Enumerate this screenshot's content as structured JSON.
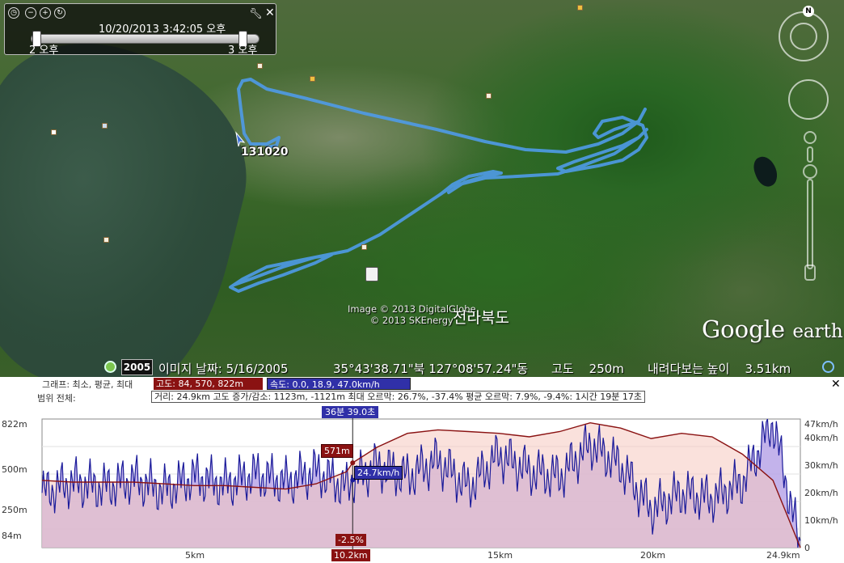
{
  "time_slider": {
    "datetime": "10/20/2013   3:42:05 오후",
    "start_label": "2 오후",
    "end_label": "3 오후"
  },
  "map": {
    "track_label": "131020",
    "copyright_line1": "Image © 2013 DigitalGlobe",
    "copyright_line2": "© 2013 SKEnergy",
    "place_label": "전라북도",
    "logo_main": "Google",
    "logo_small": "earth",
    "compass_north": "N",
    "track_color": "#4f9be8"
  },
  "status_bar": {
    "year": "2005",
    "imagery_date": "이미지 날짜: 5/16/2005",
    "coords": "35°43'38.71\"북 127°08'57.24\"동",
    "elevation": "고도    250m",
    "eye_alt": "내려다보는 높이    3.51km"
  },
  "profile": {
    "graph_label": "그래프: 최소, 평균, 최대",
    "graph_alt": "고도: 84, 570, 822m",
    "graph_speed": "속도: 0.0, 18.9, 47.0km/h",
    "range_label": "범위 전체:",
    "range_stats": "거리: 24.9km   고도 증가/감소: 1123m, -1121m   최대 오르막: 26.7%, -37.4%   평균 오르막: 7.9%, -9.4%: 1시간 19분 17초",
    "duration_tag": "36분 39.0초",
    "y_left": [
      "822m",
      "500m",
      "250m",
      "84m"
    ],
    "y_right": [
      "47km/h",
      "40km/h",
      "30km/h",
      "20km/h",
      "10km/h",
      "0"
    ],
    "x_labels": [
      "5km",
      "15km",
      "20km",
      "24.9km"
    ],
    "cursor": {
      "distance": "10.2km",
      "altitude": "571m",
      "speed": "24.7km/h",
      "slope": "-2.5%"
    },
    "colors": {
      "altitude": "#8a1212",
      "speed": "#1a1a9a",
      "altitude_fill": "#f6c9c0",
      "speed_fill": "#b9a6e8"
    }
  },
  "chart_data": {
    "type": "area",
    "xlabel": "",
    "ylabel": "",
    "xlim": [
      0,
      24.9
    ],
    "series": [
      {
        "name": "고도",
        "x": [
          0,
          1,
          2,
          3,
          4,
          5,
          6,
          7,
          8,
          9,
          10,
          10.2,
          11,
          12,
          13,
          14,
          15,
          16,
          17,
          18,
          19,
          20,
          21,
          22,
          23,
          24,
          24.9
        ],
        "values": [
          470,
          460,
          460,
          460,
          450,
          440,
          440,
          430,
          420,
          450,
          520,
          571,
          660,
          740,
          760,
          750,
          740,
          720,
          750,
          800,
          770,
          710,
          740,
          720,
          620,
          470,
          84
        ],
        "ylim": [
          84,
          822
        ]
      },
      {
        "name": "속도",
        "x": [
          0,
          1,
          2,
          3,
          4,
          5,
          6,
          7,
          8,
          9,
          10,
          10.2,
          11,
          12,
          13,
          14,
          15,
          16,
          17,
          18,
          19,
          20,
          21,
          22,
          23,
          24,
          24.9
        ],
        "values": [
          20,
          24,
          22,
          25,
          21,
          26,
          23,
          27,
          24,
          28,
          22,
          24.7,
          30,
          26,
          32,
          22,
          34,
          28,
          26,
          38,
          30,
          14,
          20,
          18,
          24,
          46,
          0
        ],
        "ylim": [
          0,
          47
        ]
      }
    ]
  }
}
